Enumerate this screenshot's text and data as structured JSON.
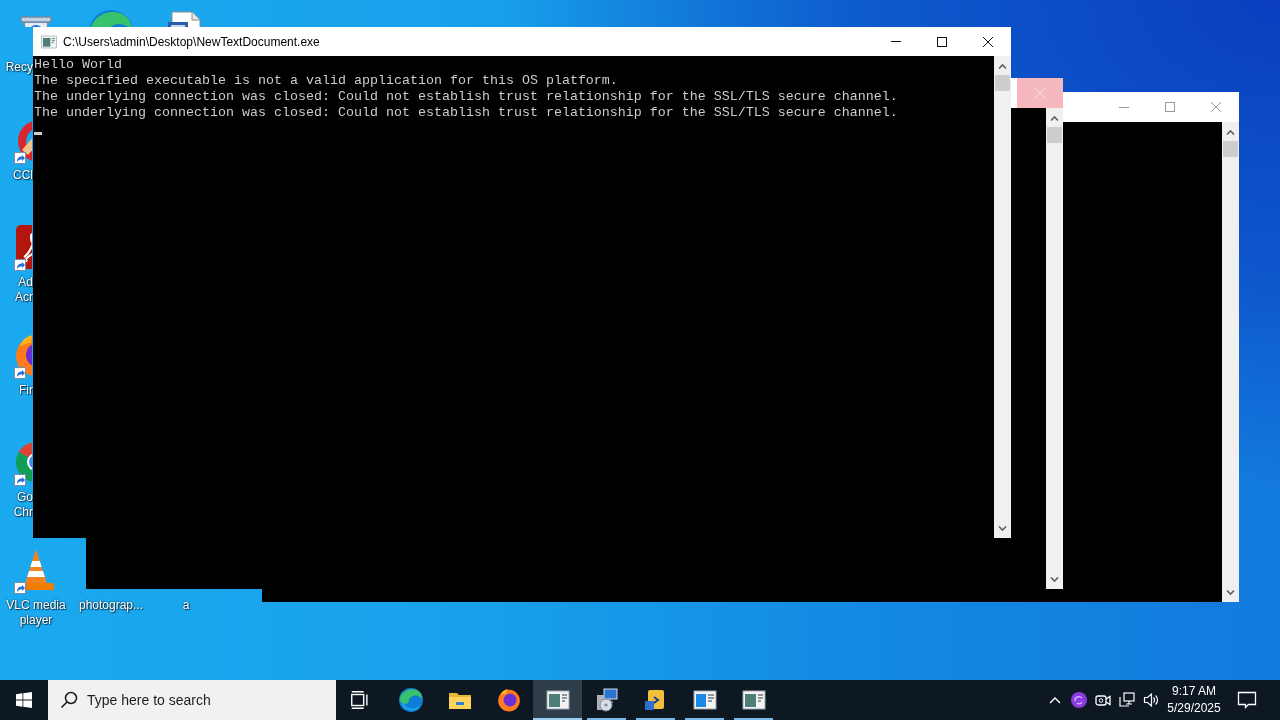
{
  "desktop_icons": [
    {
      "kind": "bin",
      "label_lines": [
        "Recy"
      ]
    },
    {
      "kind": "swirl"
    },
    {
      "kind": "page"
    },
    {
      "kind": "brush",
      "shortcut": true,
      "label_lines": [
        "CCl"
      ]
    },
    {
      "kind": "pdf",
      "shortcut": true,
      "label_lines": [
        "Ad",
        "Acr"
      ]
    },
    {
      "kind": "flame",
      "shortcut": true,
      "label_lines": [
        "Fir"
      ]
    },
    {
      "kind": "ring",
      "shortcut": true,
      "label_lines": [
        "Go",
        "Chr"
      ]
    },
    {
      "kind": "cone",
      "shortcut": true,
      "label_lines": [
        "VLC media",
        "player"
      ]
    },
    {
      "label_lines": [
        "photograp..."
      ]
    },
    {
      "label_lines": [
        "a"
      ]
    }
  ],
  "windows": [
    {
      "active": true,
      "title": "C:\\Users\\admin\\Desktop\\NewTextDocument.exe",
      "controls": [
        {
          "kind": "minimize"
        },
        {
          "kind": "maximize"
        },
        {
          "kind": "close",
          "hovered": false
        }
      ],
      "lines": [
        "Hello World",
        "The specified executable is not a valid application for this OS platform.",
        "The underlying connection was closed: Could not establish trust relationship for the SSL/TLS secure channel.",
        "The underlying connection was closed: Could not establish trust relationship for the SSL/TLS secure channel."
      ],
      "cursor": true
    },
    {
      "active": false,
      "controls": [
        {
          "kind": "close",
          "hovered": true
        }
      ]
    },
    {
      "active": false,
      "controls": [
        {
          "kind": "minimize"
        },
        {
          "kind": "maximize"
        },
        {
          "kind": "close",
          "hovered": false
        }
      ]
    }
  ],
  "taskbar": {
    "search": {
      "placeholder": "Type here to search"
    },
    "apps": [
      {
        "kind": "swirl",
        "running": false,
        "active": false
      },
      {
        "kind": "folder",
        "running": false,
        "active": false
      },
      {
        "kind": "flame",
        "running": false,
        "active": false
      },
      {
        "kind": "console",
        "running": true,
        "active": true
      },
      {
        "kind": "installer",
        "running": true,
        "active": false
      },
      {
        "kind": "script",
        "running": true,
        "active": false
      },
      {
        "kind": "window",
        "running": true,
        "active": false
      },
      {
        "kind": "console",
        "running": true,
        "active": false
      }
    ],
    "clock": {
      "time": "9:17 AM",
      "date": "5/29/2025"
    }
  }
}
